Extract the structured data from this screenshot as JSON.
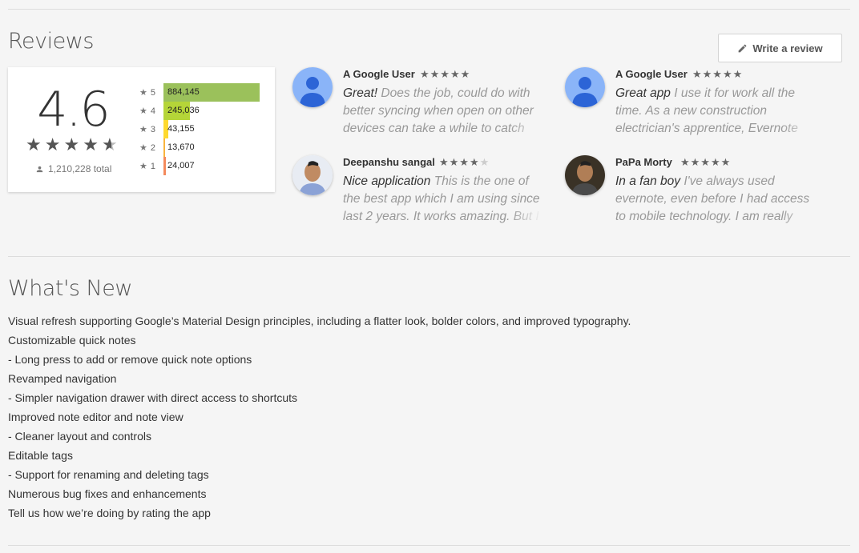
{
  "reviews_section": {
    "title": "Reviews",
    "write_review_label": "Write a review",
    "average_rating": "4.6",
    "average_stars": 4.6,
    "total_ratings": "1,210,228 total",
    "histogram": [
      {
        "stars": "5",
        "count_text": "884,145",
        "fraction": 1.0,
        "color": "#9bc15b"
      },
      {
        "stars": "4",
        "count_text": "245,036",
        "fraction": 0.277,
        "color": "#b5d538"
      },
      {
        "stars": "3",
        "count_text": "43,155",
        "fraction": 0.049,
        "color": "#fed92e"
      },
      {
        "stars": "2",
        "count_text": "13,670",
        "fraction": 0.016,
        "color": "#f9b43d"
      },
      {
        "stars": "1",
        "count_text": "24,007",
        "fraction": 0.027,
        "color": "#f48a5c"
      }
    ],
    "reviews": [
      {
        "author": "A Google User",
        "rating": 5,
        "avatar": "default-user-icon",
        "title": "Great!",
        "body": "Does the job, could do with better syncing when open on other devices can take a while to catch up"
      },
      {
        "author": "A Google User",
        "rating": 5,
        "avatar": "default-user-icon",
        "title": "Great app",
        "body": "I use it for work all the time. As a new construction electrician's apprentice, Evernote"
      },
      {
        "author": "Deepanshu sangal",
        "rating": 4,
        "avatar": "user-photo",
        "title": "Nice application",
        "body": "This is the one of the best app which I am using since last 2 years. It works amazing. But I"
      },
      {
        "author": "PaPa Morty",
        "rating": 5,
        "avatar": "user-photo",
        "title": "In a fan boy",
        "body": "I've always used evernote, even before I had access to mobile technology. I am really"
      }
    ]
  },
  "whats_new": {
    "title": "What's New",
    "lines": [
      "Visual refresh supporting Google’s Material Design principles, including a flatter look, bolder colors, and improved typography.",
      "Customizable quick notes",
      "- Long press to add or remove quick note options",
      "Revamped navigation",
      "- Simpler navigation drawer with direct access to shortcuts",
      "Improved note editor and note view",
      "- Cleaner layout and controls",
      "Editable tags",
      "- Support for renaming and deleting tags",
      "Numerous bug fixes and enhancements",
      "Tell us how we’re doing by rating the app"
    ]
  }
}
